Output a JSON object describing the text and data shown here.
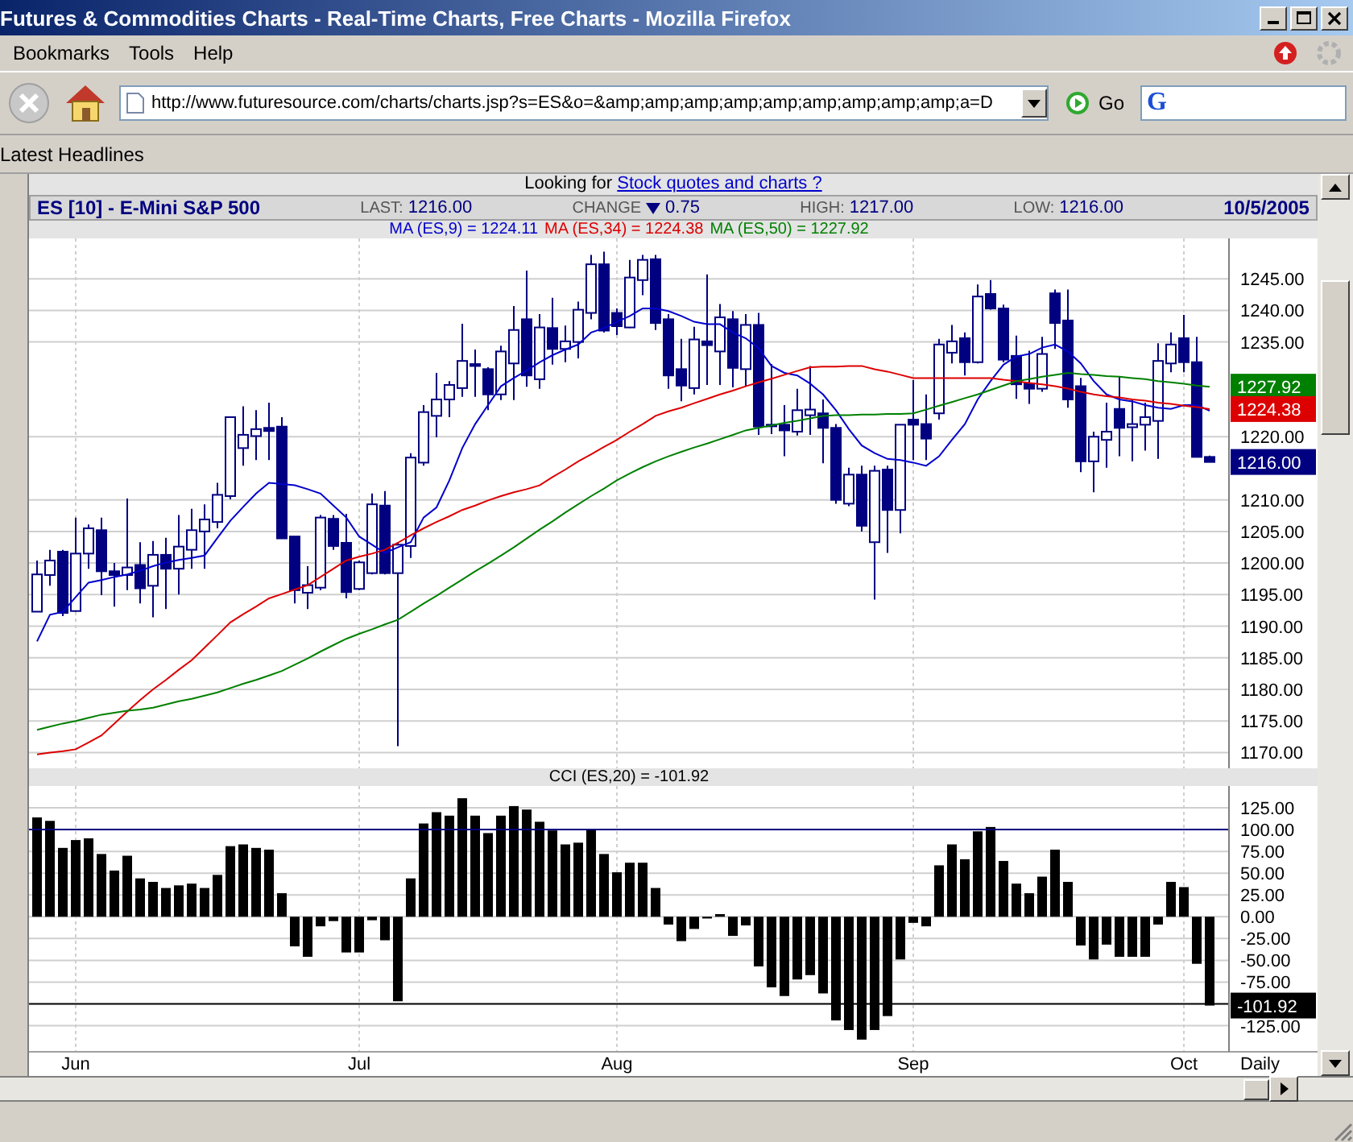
{
  "window": {
    "title": "Futures & Commodities Charts - Real-Time Charts, Free Charts - Mozilla Firefox"
  },
  "menu": [
    "Bookmarks",
    "Tools",
    "Help"
  ],
  "toolbar": {
    "url": "http://www.futuresource.com/charts/charts.jsp?s=ES&o=&amp;amp;amp;amp;amp;amp;amp;amp;amp;a=D",
    "go_label": "Go",
    "search_glyph": "G"
  },
  "bookmarks": [
    "Latest Headlines"
  ],
  "page": {
    "promo": {
      "text": "Looking for",
      "link": "Stock quotes and charts ?"
    },
    "quote": {
      "symbol": "ES [10] - E-Mini S&P 500",
      "fields": [
        {
          "label": "LAST:",
          "value": "1216.00"
        },
        {
          "label": "CHANGE",
          "falling": true,
          "value": "0.75"
        },
        {
          "label": "HIGH:",
          "value": "1217.00"
        },
        {
          "label": "LOW:",
          "value": "1216.00"
        }
      ],
      "date": "10/5/2005"
    },
    "price_chart": {
      "chart_data": {
        "type": "candlestick",
        "grid": true,
        "ylim": [
          1167.5,
          1251.4
        ],
        "categories": [
          null,
          null,
          null,
          null,
          null,
          null,
          null,
          null,
          null,
          null,
          null,
          null,
          null,
          null,
          null,
          null,
          null,
          null,
          null,
          null,
          null,
          null,
          null,
          null,
          null,
          null,
          null,
          null,
          null,
          null,
          null,
          null,
          null,
          null,
          null,
          null,
          null,
          null,
          null,
          null,
          null,
          null,
          null,
          null,
          null,
          null,
          null,
          null,
          null,
          null,
          null,
          null,
          null,
          null,
          null,
          null,
          null,
          null,
          null,
          null,
          null,
          null,
          null,
          null,
          null,
          null,
          null,
          null,
          null,
          null,
          null,
          null,
          null,
          null,
          null,
          null,
          null,
          null,
          null,
          null,
          null,
          null,
          null,
          null,
          null,
          null,
          null,
          null,
          null,
          null,
          null,
          null
        ],
        "yticks": [
          {
            "value": 1245,
            "label": "1245.00"
          },
          {
            "value": 1240,
            "label": "1240.00"
          },
          {
            "value": 1235,
            "label": "1235.00"
          },
          {
            "value": 1220,
            "label": "1220.00"
          },
          {
            "value": 1210,
            "label": "1210.00"
          },
          {
            "value": 1205,
            "label": "1205.00"
          },
          {
            "value": 1200,
            "label": "1200.00"
          },
          {
            "value": 1195,
            "label": "1195.00"
          },
          {
            "value": 1190,
            "label": "1190.00"
          },
          {
            "value": 1185,
            "label": "1185.00"
          },
          {
            "value": 1180,
            "label": "1180.00"
          },
          {
            "value": 1175,
            "label": "1175.00"
          },
          {
            "value": 1170,
            "label": "1170.00"
          }
        ],
        "ohlc": [
          [
            1192.3,
            1200.4,
            1192.3,
            1198.2
          ],
          [
            1198.1,
            1202.1,
            1196.4,
            1200.4
          ],
          [
            1201.8,
            1202.1,
            1191.6,
            1192.1
          ],
          [
            1192.4,
            1207.2,
            1192.3,
            1201.5
          ],
          [
            1201.5,
            1206.1,
            1199.1,
            1205.5
          ],
          [
            1205.2,
            1207.2,
            1194.9,
            1198.7
          ],
          [
            1198.7,
            1200.0,
            1193.1,
            1198.1
          ],
          [
            1198.1,
            1210.2,
            1195.7,
            1199.3
          ],
          [
            1199.7,
            1203.3,
            1193.6,
            1196.0
          ],
          [
            1196.4,
            1203.5,
            1191.4,
            1201.3
          ],
          [
            1201.3,
            1204.0,
            1192.7,
            1199.1
          ],
          [
            1199.1,
            1207.6,
            1195.0,
            1202.6
          ],
          [
            1202.1,
            1208.6,
            1199.1,
            1205.2
          ],
          [
            1205.0,
            1209.3,
            1199.1,
            1206.9
          ],
          [
            1206.5,
            1212.7,
            1205.5,
            1210.8
          ],
          [
            1210.6,
            1223.1,
            1210.1,
            1223.1
          ],
          [
            1218.2,
            1224.8,
            1215.4,
            1220.3
          ],
          [
            1220.1,
            1224.2,
            1216.3,
            1221.2
          ],
          [
            1221.4,
            1225.4,
            1216.3,
            1220.9
          ],
          [
            1221.6,
            1223.1,
            1203.9,
            1203.9
          ],
          [
            1204.2,
            1204.2,
            1193.6,
            1195.7
          ],
          [
            1195.3,
            1199.5,
            1192.7,
            1196.5
          ],
          [
            1196.1,
            1207.6,
            1195.7,
            1207.2
          ],
          [
            1207.0,
            1207.6,
            1202.1,
            1202.7
          ],
          [
            1203.2,
            1207.8,
            1194.4,
            1195.4
          ],
          [
            1195.9,
            1200.4,
            1195.7,
            1200.1
          ],
          [
            1198.4,
            1211.0,
            1198.2,
            1209.3
          ],
          [
            1209.1,
            1211.4,
            1198.2,
            1198.4
          ],
          [
            1198.4,
            1203.3,
            1171.0,
            1202.9
          ],
          [
            1202.7,
            1217.4,
            1200.8,
            1216.7
          ],
          [
            1215.9,
            1225.0,
            1215.4,
            1223.9
          ],
          [
            1223.3,
            1230.1,
            1219.9,
            1225.9
          ],
          [
            1225.9,
            1228.8,
            1223.1,
            1228.2
          ],
          [
            1227.7,
            1237.9,
            1226.3,
            1232.0
          ],
          [
            1231.5,
            1233.8,
            1226.3,
            1231.2
          ],
          [
            1230.7,
            1231.0,
            1224.2,
            1226.7
          ],
          [
            1226.7,
            1234.4,
            1225.8,
            1233.5
          ],
          [
            1231.6,
            1240.7,
            1225.8,
            1236.9
          ],
          [
            1238.6,
            1246.3,
            1227.9,
            1229.7
          ],
          [
            1229.1,
            1239.4,
            1227.6,
            1237.3
          ],
          [
            1237.2,
            1242.0,
            1231.4,
            1233.9
          ],
          [
            1233.9,
            1237.6,
            1231.8,
            1235.1
          ],
          [
            1235.0,
            1241.4,
            1232.4,
            1240.1
          ],
          [
            1239.6,
            1248.8,
            1238.6,
            1247.3
          ],
          [
            1247.3,
            1249.3,
            1236.5,
            1236.8
          ],
          [
            1239.6,
            1240.3,
            1236.1,
            1237.5
          ],
          [
            1237.3,
            1248.0,
            1237.2,
            1245.2
          ],
          [
            1244.8,
            1248.8,
            1242.4,
            1248.0
          ],
          [
            1248.1,
            1248.8,
            1236.9,
            1238.0
          ],
          [
            1238.6,
            1239.4,
            1227.6,
            1229.7
          ],
          [
            1230.7,
            1235.5,
            1225.6,
            1228.1
          ],
          [
            1227.7,
            1237.4,
            1226.7,
            1235.4
          ],
          [
            1235.1,
            1245.7,
            1228.2,
            1234.5
          ],
          [
            1233.5,
            1241.0,
            1228.2,
            1238.9
          ],
          [
            1238.6,
            1239.9,
            1227.8,
            1230.9
          ],
          [
            1230.7,
            1239.4,
            1228.0,
            1237.7
          ],
          [
            1237.7,
            1239.6,
            1220.3,
            1221.6
          ],
          [
            1221.7,
            1231.5,
            1220.4,
            1221.9
          ],
          [
            1221.9,
            1225.0,
            1216.9,
            1221.0
          ],
          [
            1220.8,
            1227.6,
            1220.2,
            1224.2
          ],
          [
            1223.4,
            1231.2,
            1220.3,
            1224.3
          ],
          [
            1223.7,
            1225.9,
            1215.8,
            1221.4
          ],
          [
            1221.4,
            1222.0,
            1209.4,
            1210.0
          ],
          [
            1209.4,
            1215.1,
            1209.0,
            1214.0
          ],
          [
            1214.0,
            1215.4,
            1205.0,
            1205.9
          ],
          [
            1203.3,
            1215.4,
            1194.2,
            1214.6
          ],
          [
            1214.8,
            1215.4,
            1201.6,
            1208.4
          ],
          [
            1208.4,
            1221.9,
            1204.7,
            1221.9
          ],
          [
            1222.7,
            1229.0,
            1216.3,
            1221.9
          ],
          [
            1222.0,
            1226.7,
            1216.3,
            1219.7
          ],
          [
            1223.7,
            1235.5,
            1222.7,
            1234.6
          ],
          [
            1233.3,
            1237.7,
            1231.6,
            1235.1
          ],
          [
            1235.6,
            1236.5,
            1229.7,
            1231.8
          ],
          [
            1231.8,
            1244.1,
            1231.6,
            1242.2
          ],
          [
            1242.6,
            1244.8,
            1240.1,
            1240.3
          ],
          [
            1240.3,
            1240.9,
            1231.8,
            1232.2
          ],
          [
            1232.8,
            1236.0,
            1226.0,
            1228.3
          ],
          [
            1228.4,
            1233.6,
            1225.2,
            1227.6
          ],
          [
            1227.6,
            1235.8,
            1227.1,
            1233.1
          ],
          [
            1242.7,
            1243.3,
            1233.9,
            1238.0
          ],
          [
            1238.4,
            1243.3,
            1224.6,
            1225.9
          ],
          [
            1228.0,
            1229.3,
            1214.4,
            1216.1
          ],
          [
            1216.1,
            1220.8,
            1211.2,
            1220.0
          ],
          [
            1219.5,
            1225.4,
            1215.1,
            1220.8
          ],
          [
            1224.4,
            1229.5,
            1216.9,
            1221.4
          ],
          [
            1221.5,
            1225.9,
            1216.1,
            1222.0
          ],
          [
            1221.9,
            1225.4,
            1217.8,
            1223.1
          ],
          [
            1222.5,
            1234.8,
            1216.5,
            1232.0
          ],
          [
            1231.6,
            1236.5,
            1230.2,
            1234.6
          ],
          [
            1235.6,
            1239.3,
            1230.2,
            1231.8
          ],
          [
            1231.8,
            1235.8,
            1216.8,
            1216.8
          ],
          [
            1216.8,
            1217.0,
            1216.0,
            1216.0
          ]
        ],
        "series": [
          {
            "name": "MA (ES,9) = 1224.11",
            "type": "line",
            "color": "#0000cc",
            "values": [
              1187.6,
              1191.8,
              1192.3,
              1194.6,
              1196.9,
              1197.3,
              1197.8,
              1198.2,
              1198.8,
              1199.5,
              1200.1,
              1200.5,
              1200.8,
              1201.2,
              1204.0,
              1206.7,
              1208.9,
              1211.0,
              1212.7,
              1212.5,
              1212.3,
              1211.7,
              1211.0,
              1209.1,
              1207.2,
              1204.2,
              1202.9,
              1201.6,
              1202.5,
              1203.3,
              1207.2,
              1208.8,
              1213.1,
              1218.2,
              1222.0,
              1225.0,
              1228.0,
              1229.3,
              1230.5,
              1231.8,
              1232.9,
              1233.8,
              1234.6,
              1236.5,
              1237.2,
              1238.2,
              1239.1,
              1240.3,
              1240.3,
              1239.9,
              1239.1,
              1238.2,
              1237.8,
              1237.8,
              1236.5,
              1235.6,
              1234.0,
              1231.2,
              1230.1,
              1229.7,
              1228.4,
              1226.7,
              1224.2,
              1221.2,
              1218.6,
              1217.4,
              1216.5,
              1216.3,
              1215.9,
              1215.4,
              1216.9,
              1219.5,
              1222.0,
              1225.9,
              1228.8,
              1231.4,
              1232.7,
              1233.1,
              1234.1,
              1234.6,
              1233.5,
              1231.6,
              1228.8,
              1226.7,
              1225.9,
              1225.6,
              1225.0,
              1224.6,
              1224.4,
              1225.0,
              1225.0,
              1224.11
            ]
          },
          {
            "name": "MA (ES,34) = 1224.38",
            "type": "line",
            "color": "#dd0000",
            "values": [
              1169.7,
              1170.0,
              1170.2,
              1170.5,
              1171.6,
              1172.7,
              1174.6,
              1176.5,
              1178.3,
              1180.0,
              1181.5,
              1183.1,
              1184.6,
              1186.6,
              1188.6,
              1190.6,
              1191.9,
              1193.1,
              1194.4,
              1195.1,
              1195.8,
              1196.5,
              1197.8,
              1199.1,
              1200.4,
              1201.0,
              1201.5,
              1202.1,
              1203.2,
              1204.4,
              1205.5,
              1206.5,
              1207.4,
              1208.4,
              1209.1,
              1209.9,
              1210.6,
              1211.2,
              1211.7,
              1212.3,
              1213.6,
              1214.8,
              1216.1,
              1217.2,
              1218.4,
              1219.5,
              1220.8,
              1222.0,
              1223.3,
              1224.0,
              1224.6,
              1225.3,
              1226.0,
              1226.7,
              1227.3,
              1228.0,
              1228.6,
              1229.2,
              1229.8,
              1230.4,
              1231.0,
              1231.1,
              1231.1,
              1231.2,
              1231.2,
              1230.7,
              1230.3,
              1229.8,
              1229.3,
              1229.3,
              1229.3,
              1229.3,
              1229.3,
              1229.3,
              1229.3,
              1229.0,
              1228.8,
              1228.5,
              1228.3,
              1228.0,
              1227.6,
              1227.1,
              1226.7,
              1226.4,
              1226.2,
              1225.9,
              1225.7,
              1225.4,
              1225.2,
              1224.9,
              1224.7,
              1224.38
            ]
          },
          {
            "name": "MA (ES,50) = 1227.92",
            "type": "line",
            "color": "#008000",
            "values": [
              1173.6,
              1174.1,
              1174.6,
              1175.0,
              1175.5,
              1176.0,
              1176.3,
              1176.6,
              1176.8,
              1177.1,
              1177.6,
              1178.1,
              1178.5,
              1179.0,
              1179.5,
              1180.2,
              1180.9,
              1181.5,
              1182.2,
              1182.9,
              1183.9,
              1184.9,
              1186.0,
              1187.0,
              1188.0,
              1188.8,
              1189.5,
              1190.3,
              1191.0,
              1192.3,
              1193.6,
              1194.8,
              1196.1,
              1197.4,
              1198.7,
              1199.9,
              1201.2,
              1202.5,
              1203.9,
              1205.3,
              1206.6,
              1208.0,
              1209.3,
              1210.6,
              1211.8,
              1213.1,
              1214.2,
              1215.2,
              1216.1,
              1216.9,
              1217.6,
              1218.3,
              1218.9,
              1219.6,
              1220.3,
              1221.0,
              1221.4,
              1221.8,
              1222.2,
              1222.5,
              1222.9,
              1223.3,
              1223.4,
              1223.4,
              1223.5,
              1223.5,
              1223.6,
              1223.6,
              1223.7,
              1224.3,
              1224.9,
              1225.5,
              1226.1,
              1226.7,
              1227.4,
              1228.1,
              1228.8,
              1229.1,
              1229.5,
              1229.8,
              1230.1,
              1229.9,
              1229.8,
              1229.6,
              1229.5,
              1229.3,
              1229.1,
              1228.8,
              1228.6,
              1228.4,
              1228.1,
              1227.92
            ]
          }
        ],
        "annotations": [
          "1227.92",
          "1224.38",
          "1216.00"
        ]
      }
    },
    "cci_chart": {
      "chart_data": {
        "type": "bar",
        "grid": true,
        "ylim": [
          -155,
          150
        ],
        "categories": [
          null,
          null,
          null,
          "Jun",
          null,
          null,
          null,
          null,
          null,
          null,
          null,
          null,
          null,
          null,
          null,
          null,
          null,
          null,
          null,
          null,
          null,
          null,
          null,
          null,
          null,
          "Jul",
          null,
          null,
          null,
          null,
          null,
          null,
          null,
          null,
          null,
          null,
          null,
          null,
          null,
          null,
          null,
          null,
          null,
          null,
          null,
          "Aug",
          null,
          null,
          null,
          null,
          null,
          null,
          null,
          null,
          null,
          null,
          null,
          null,
          null,
          null,
          null,
          null,
          null,
          null,
          null,
          null,
          null,
          null,
          "Sep",
          null,
          null,
          null,
          null,
          null,
          null,
          null,
          null,
          null,
          null,
          null,
          null,
          null,
          null,
          null,
          null,
          null,
          null,
          null,
          null,
          "Oct",
          null,
          null
        ],
        "yticks": [
          {
            "value": 125,
            "label": "125.00"
          },
          {
            "value": 100,
            "label": "100.00"
          },
          {
            "value": 75,
            "label": "75.00"
          },
          {
            "value": 50,
            "label": "50.00"
          },
          {
            "value": 25,
            "label": "25.00"
          },
          {
            "value": 0,
            "label": "0.00"
          },
          {
            "value": -25,
            "label": "-25.00"
          },
          {
            "value": -50,
            "label": "-50.00"
          },
          {
            "value": -75,
            "label": "-75.00"
          },
          {
            "value": -125,
            "label": "-125.00"
          }
        ],
        "series": [
          {
            "name": "CCI (ES,20) = -101.92",
            "color": "#000000",
            "values": [
              114,
              110,
              79,
              88,
              90,
              72,
              53,
              70,
              44,
              40,
              33,
              36,
              38,
              33,
              48,
              81,
              83,
              79,
              77,
              27,
              -34,
              -46,
              -11,
              -5,
              -41,
              -41,
              -4,
              -27,
              -97,
              44,
              107,
              120,
              116,
              136,
              116,
              96,
              116,
              127,
              123,
              109,
              99,
              83,
              85,
              101,
              72,
              51,
              62,
              62,
              33,
              -9,
              -28,
              -14,
              -2,
              3,
              -22,
              -10,
              -57,
              -81,
              -91,
              -72,
              -67,
              -88,
              -119,
              -130,
              -141,
              -130,
              -114,
              -49,
              -7,
              -11,
              59,
              83,
              66,
              98,
              103,
              64,
              38,
              27,
              46,
              77,
              40,
              -33,
              -49,
              -32,
              -46,
              -46,
              -46,
              -9,
              40,
              34,
              -54,
              -101.92
            ]
          }
        ],
        "ref_lines": [
          {
            "axis": "y",
            "value": 100,
            "color": "#000080"
          },
          {
            "axis": "y",
            "value": -100,
            "color": "#000000"
          }
        ],
        "annotations": [
          "-101.92"
        ]
      },
      "period_label": "Daily"
    }
  }
}
